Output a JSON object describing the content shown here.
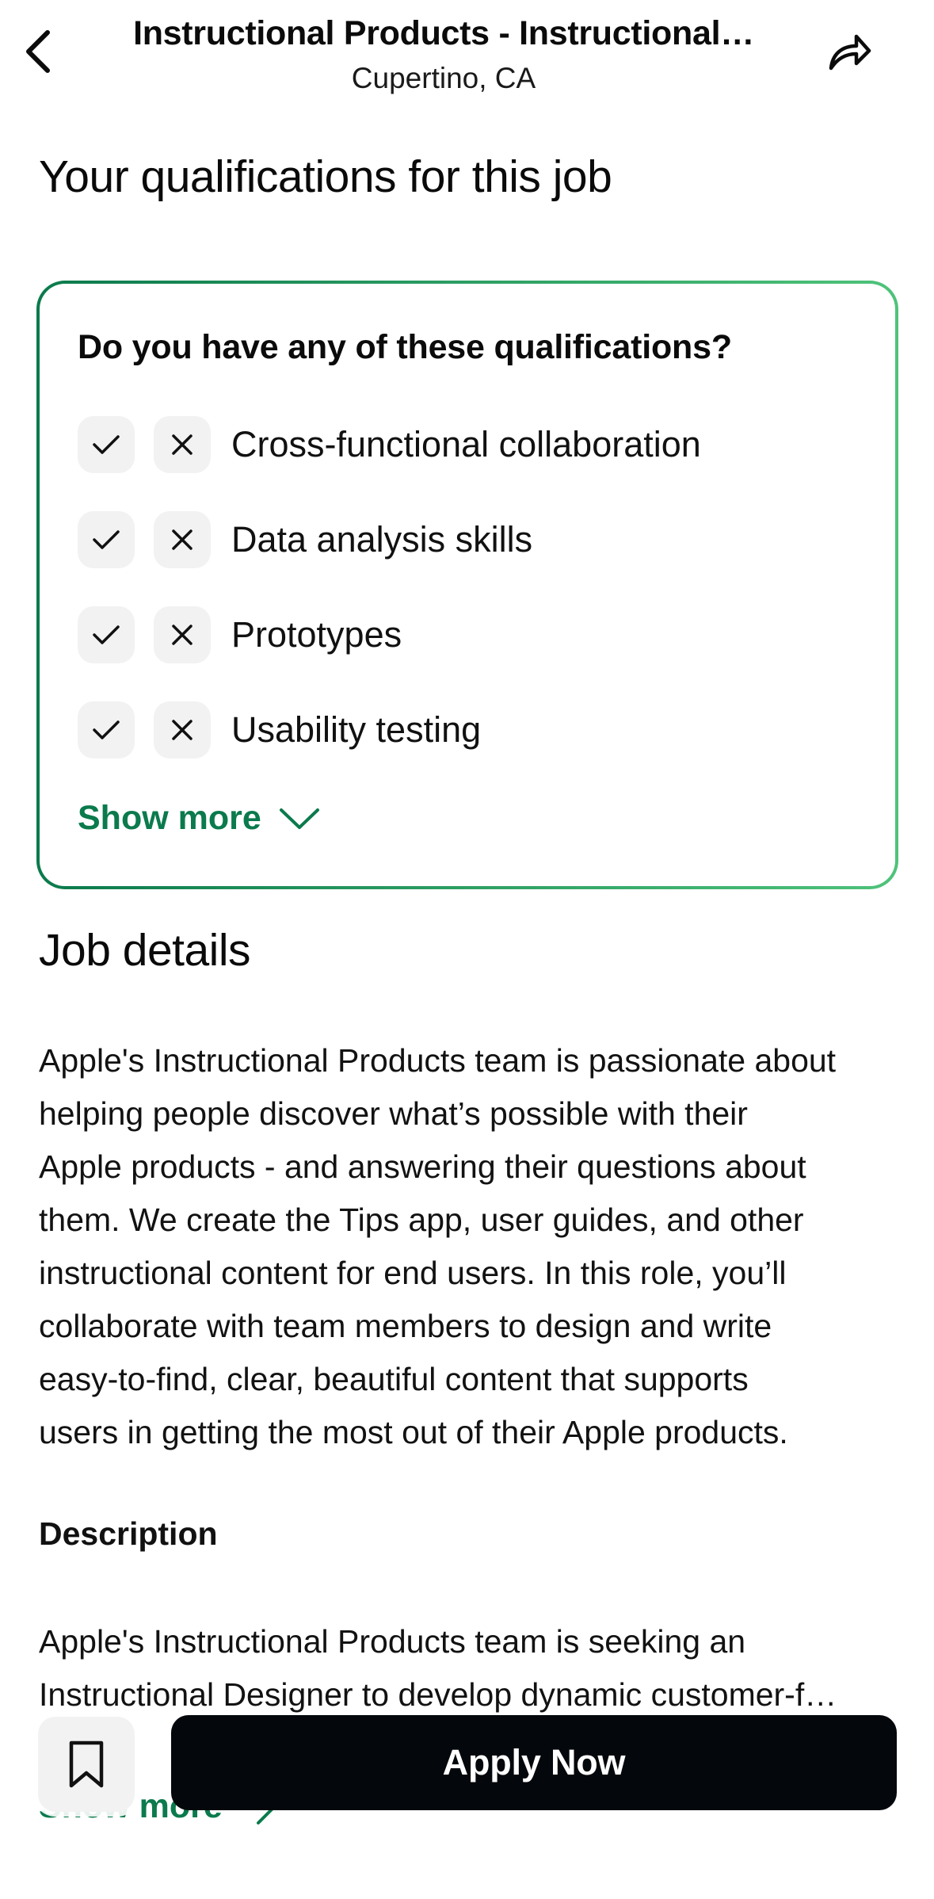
{
  "header": {
    "title": "Instructional Products - Instructional…",
    "location": "Cupertino, CA",
    "back_icon": "chevron-left-icon",
    "share_icon": "share-arrow-icon"
  },
  "qualifications": {
    "section_title": "Your qualifications for this job",
    "question": "Do you have any of these qualifications?",
    "items": [
      {
        "label": "Cross-functional collaboration"
      },
      {
        "label": "Data analysis skills"
      },
      {
        "label": "Prototypes"
      },
      {
        "label": "Usability testing"
      }
    ],
    "show_more": "Show more"
  },
  "job_details": {
    "section_title": "Job details",
    "summary_lines": [
      "Apple's Instructional Products team is passionate about",
      "helping people discover what’s possible with their",
      "Apple products - and answering their questions about",
      "them. We create the Tips app, user guides, and other",
      "instructional content for end users. In this role, you’ll",
      "collaborate with team members to design and write",
      "easy-to-find, clear, beautiful content that supports",
      "users in getting the most out of their Apple products."
    ],
    "description_heading": "Description",
    "description_lines": [
      "Apple's Instructional Products team is seeking an",
      "Instructional Designer to develop dynamic customer-f…"
    ],
    "show_more": "Show more"
  },
  "bottom_bar": {
    "apply_label": "Apply Now",
    "bookmark_icon": "bookmark-icon"
  },
  "colors": {
    "accent_green": "#0b7a4c",
    "gradient_end": "#4fc37a",
    "button_dark": "#04070b",
    "chip_bg": "#f2f2f3"
  }
}
